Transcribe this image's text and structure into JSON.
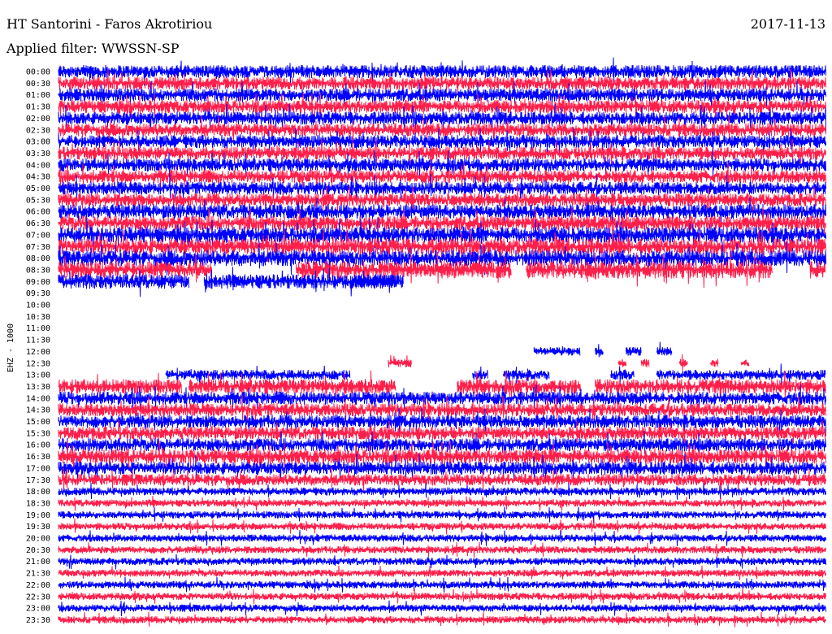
{
  "header": {
    "station": "HT Santorini - Faros Akrotiriou",
    "date": "2017-11-13",
    "filter": "Applied filter: WWSSN-SP"
  },
  "chart_data": {
    "type": "line",
    "title": "HT Santorini - Faros Akrotiriou",
    "ylabel": "EHZ - 1000",
    "xlabel": "",
    "colors": {
      "even_rows": "#0000ff",
      "odd_rows": "#ff1f4b"
    },
    "rows": [
      {
        "label": "00:00",
        "amp": 0.9,
        "segments": [
          [
            0,
            1
          ]
        ]
      },
      {
        "label": "00:30",
        "amp": 0.9,
        "segments": [
          [
            0,
            1
          ]
        ]
      },
      {
        "label": "01:00",
        "amp": 0.9,
        "segments": [
          [
            0,
            1
          ]
        ]
      },
      {
        "label": "01:30",
        "amp": 0.9,
        "segments": [
          [
            0,
            1
          ]
        ]
      },
      {
        "label": "02:00",
        "amp": 0.9,
        "segments": [
          [
            0,
            1
          ]
        ]
      },
      {
        "label": "02:30",
        "amp": 0.9,
        "segments": [
          [
            0,
            1
          ]
        ]
      },
      {
        "label": "03:00",
        "amp": 0.9,
        "segments": [
          [
            0,
            1
          ]
        ]
      },
      {
        "label": "03:30",
        "amp": 0.9,
        "segments": [
          [
            0,
            1
          ]
        ]
      },
      {
        "label": "04:00",
        "amp": 0.9,
        "segments": [
          [
            0,
            1
          ]
        ]
      },
      {
        "label": "04:30",
        "amp": 0.9,
        "segments": [
          [
            0,
            1
          ]
        ]
      },
      {
        "label": "05:00",
        "amp": 0.9,
        "segments": [
          [
            0,
            1
          ]
        ]
      },
      {
        "label": "05:30",
        "amp": 0.9,
        "segments": [
          [
            0,
            1
          ]
        ]
      },
      {
        "label": "06:00",
        "amp": 1.0,
        "segments": [
          [
            0,
            1
          ]
        ]
      },
      {
        "label": "06:30",
        "amp": 1.0,
        "segments": [
          [
            0,
            1
          ]
        ]
      },
      {
        "label": "07:00",
        "amp": 1.1,
        "segments": [
          [
            0,
            1
          ]
        ]
      },
      {
        "label": "07:30",
        "amp": 1.1,
        "segments": [
          [
            0,
            1
          ]
        ]
      },
      {
        "label": "08:00",
        "amp": 1.1,
        "segments": [
          [
            0,
            1
          ]
        ]
      },
      {
        "label": "08:30",
        "amp": 1.2,
        "segments": [
          [
            0,
            0.2
          ],
          [
            0.31,
            0.59
          ],
          [
            0.61,
            0.93
          ],
          [
            0.98,
            1
          ]
        ]
      },
      {
        "label": "09:00",
        "amp": 1.0,
        "segments": [
          [
            0,
            0.17
          ],
          [
            0.19,
            0.36
          ],
          [
            0.38,
            0.42
          ],
          [
            0.44,
            0.41
          ],
          [
            0.36,
            0.45
          ]
        ]
      },
      {
        "label": "09:30",
        "amp": 0,
        "segments": []
      },
      {
        "label": "10:00",
        "amp": 0,
        "segments": []
      },
      {
        "label": "10:30",
        "amp": 0,
        "segments": []
      },
      {
        "label": "11:00",
        "amp": 0,
        "segments": []
      },
      {
        "label": "11:30",
        "amp": 0,
        "segments": []
      },
      {
        "label": "12:00",
        "amp": 0.6,
        "segments": [
          [
            0.62,
            0.68
          ],
          [
            0.7,
            0.71
          ],
          [
            0.74,
            0.76
          ],
          [
            0.78,
            0.8
          ]
        ]
      },
      {
        "label": "12:30",
        "amp": 0.6,
        "segments": [
          [
            0.43,
            0.46
          ],
          [
            0.73,
            0.74
          ],
          [
            0.76,
            0.77
          ],
          [
            0.81,
            0.82
          ],
          [
            0.85,
            0.86
          ],
          [
            0.89,
            0.9
          ]
        ]
      },
      {
        "label": "13:00",
        "amp": 0.7,
        "segments": [
          [
            0.14,
            0.38
          ],
          [
            0.54,
            0.56
          ],
          [
            0.58,
            0.64
          ],
          [
            0.72,
            0.75
          ],
          [
            0.78,
            1
          ]
        ]
      },
      {
        "label": "13:30",
        "amp": 1.0,
        "segments": [
          [
            0,
            0.16
          ],
          [
            0.17,
            0.44
          ],
          [
            0.52,
            0.68
          ],
          [
            0.7,
            1
          ]
        ]
      },
      {
        "label": "14:00",
        "amp": 0.9,
        "segments": [
          [
            0,
            1
          ]
        ]
      },
      {
        "label": "14:30",
        "amp": 0.9,
        "segments": [
          [
            0,
            1
          ]
        ]
      },
      {
        "label": "15:00",
        "amp": 0.9,
        "segments": [
          [
            0,
            1
          ]
        ]
      },
      {
        "label": "15:30",
        "amp": 0.9,
        "segments": [
          [
            0,
            1
          ]
        ]
      },
      {
        "label": "16:00",
        "amp": 0.9,
        "segments": [
          [
            0,
            1
          ]
        ]
      },
      {
        "label": "16:30",
        "amp": 1.0,
        "segments": [
          [
            0,
            1
          ]
        ]
      },
      {
        "label": "17:00",
        "amp": 0.9,
        "segments": [
          [
            0,
            1
          ]
        ]
      },
      {
        "label": "17:30",
        "amp": 0.8,
        "segments": [
          [
            0,
            1
          ]
        ]
      },
      {
        "label": "18:00",
        "amp": 0.55,
        "segments": [
          [
            0,
            1
          ]
        ]
      },
      {
        "label": "18:30",
        "amp": 0.5,
        "segments": [
          [
            0,
            1
          ]
        ]
      },
      {
        "label": "19:00",
        "amp": 0.5,
        "segments": [
          [
            0,
            1
          ]
        ]
      },
      {
        "label": "19:30",
        "amp": 0.5,
        "segments": [
          [
            0,
            1
          ]
        ]
      },
      {
        "label": "20:00",
        "amp": 0.5,
        "segments": [
          [
            0,
            1
          ]
        ]
      },
      {
        "label": "20:30",
        "amp": 0.5,
        "segments": [
          [
            0,
            1
          ]
        ]
      },
      {
        "label": "21:00",
        "amp": 0.5,
        "segments": [
          [
            0,
            1
          ]
        ]
      },
      {
        "label": "21:30",
        "amp": 0.5,
        "segments": [
          [
            0,
            1
          ]
        ]
      },
      {
        "label": "22:00",
        "amp": 0.5,
        "segments": [
          [
            0,
            1
          ]
        ]
      },
      {
        "label": "22:30",
        "amp": 0.5,
        "segments": [
          [
            0,
            1
          ]
        ]
      },
      {
        "label": "23:00",
        "amp": 0.5,
        "segments": [
          [
            0,
            1
          ]
        ]
      },
      {
        "label": "23:30",
        "amp": 0.5,
        "segments": [
          [
            0,
            1
          ]
        ]
      }
    ]
  }
}
